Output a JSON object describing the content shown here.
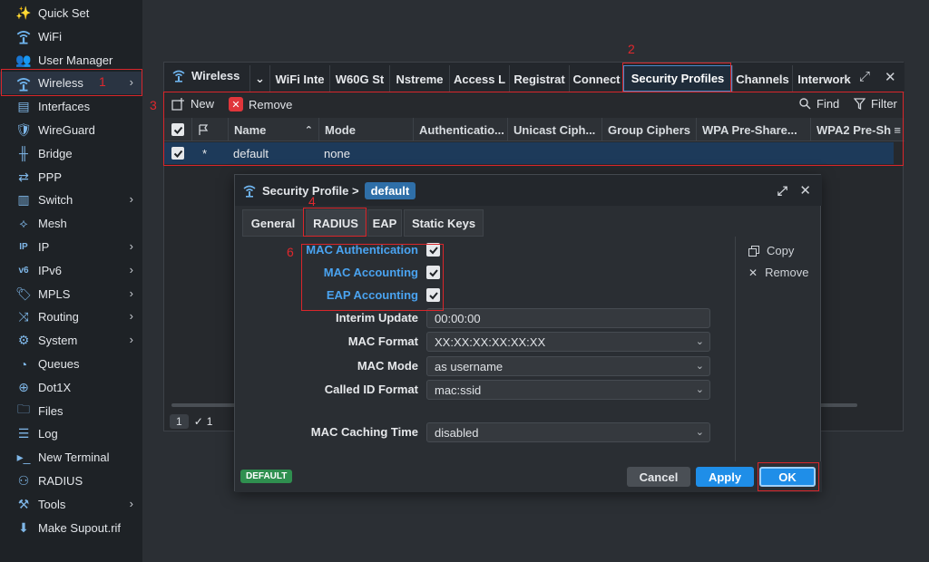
{
  "sidebar": {
    "items": [
      {
        "label": "Quick Set",
        "icon": "wand-icon",
        "chevron": false
      },
      {
        "label": "WiFi",
        "icon": "wifi-icon",
        "chevron": false
      },
      {
        "label": "User Manager",
        "icon": "users-icon",
        "chevron": false
      },
      {
        "label": "Wireless",
        "icon": "wireless-icon",
        "chevron": true
      },
      {
        "label": "Interfaces",
        "icon": "interfaces-icon",
        "chevron": false
      },
      {
        "label": "WireGuard",
        "icon": "wireguard-icon",
        "chevron": false
      },
      {
        "label": "Bridge",
        "icon": "bridge-icon",
        "chevron": false
      },
      {
        "label": "PPP",
        "icon": "ppp-icon",
        "chevron": false
      },
      {
        "label": "Switch",
        "icon": "switch-icon",
        "chevron": true
      },
      {
        "label": "Mesh",
        "icon": "mesh-icon",
        "chevron": false
      },
      {
        "label": "IP",
        "icon": "ip-icon",
        "chevron": true
      },
      {
        "label": "IPv6",
        "icon": "ipv6-icon",
        "chevron": true
      },
      {
        "label": "MPLS",
        "icon": "mpls-icon",
        "chevron": true
      },
      {
        "label": "Routing",
        "icon": "routing-icon",
        "chevron": true
      },
      {
        "label": "System",
        "icon": "gear-icon",
        "chevron": true
      },
      {
        "label": "Queues",
        "icon": "queues-icon",
        "chevron": false
      },
      {
        "label": "Dot1X",
        "icon": "dot1x-icon",
        "chevron": false
      },
      {
        "label": "Files",
        "icon": "files-icon",
        "chevron": false
      },
      {
        "label": "Log",
        "icon": "log-icon",
        "chevron": false
      },
      {
        "label": "New Terminal",
        "icon": "terminal-icon",
        "chevron": false
      },
      {
        "label": "RADIUS",
        "icon": "radius-icon",
        "chevron": false
      },
      {
        "label": "Tools",
        "icon": "tools-icon",
        "chevron": true
      },
      {
        "label": "Make Supout.rif",
        "icon": "supout-icon",
        "chevron": false
      }
    ]
  },
  "annotations": {
    "n1": "1",
    "n2": "2",
    "n3": "3",
    "n4": "4",
    "n6": "6"
  },
  "wireless": {
    "title": "Wireless",
    "tabs": [
      "WiFi Inte",
      "W60G St",
      "Nstreme",
      "Access L",
      "Registrat",
      "Connect",
      "Security Profiles",
      "Channels",
      "Interwork"
    ],
    "toolbar": {
      "new": "New",
      "remove": "Remove",
      "find": "Find",
      "filter": "Filter"
    },
    "columns": [
      "Name",
      "Mode",
      "Authenticatio...",
      "Unicast Ciph...",
      "Group Ciphers",
      "WPA Pre-Share...",
      "WPA2 Pre-Sh"
    ],
    "row": {
      "flag": "*",
      "name": "default",
      "mode": "none"
    },
    "footer": {
      "count": "1",
      "selected": "1"
    }
  },
  "dialog": {
    "title": "Security Profile >",
    "name": "default",
    "tabs": [
      "General",
      "RADIUS",
      "EAP",
      "Static Keys"
    ],
    "fields": {
      "mac_auth": "MAC Authentication",
      "mac_acct": "MAC Accounting",
      "eap_acct": "EAP Accounting",
      "interim_label": "Interim Update",
      "interim_value": "00:00:00",
      "mac_format_label": "MAC Format",
      "mac_format_value": "XX:XX:XX:XX:XX:XX",
      "mac_mode_label": "MAC Mode",
      "mac_mode_value": "as username",
      "called_id_label": "Called ID Format",
      "called_id_value": "mac:ssid",
      "caching_label": "MAC Caching Time",
      "caching_value": "disabled"
    },
    "side": {
      "copy": "Copy",
      "remove": "Remove"
    },
    "footer": {
      "status": "DEFAULT",
      "cancel": "Cancel",
      "apply": "Apply",
      "ok": "OK"
    }
  },
  "colors": {
    "accent": "#1f8ee8",
    "annotation": "#d9262b",
    "status": "#2f8f4f"
  }
}
